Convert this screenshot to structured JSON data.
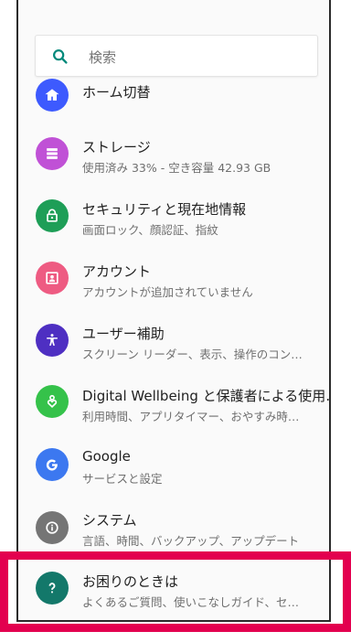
{
  "search": {
    "placeholder": "検索"
  },
  "items": [
    {
      "title": "ホーム切替",
      "subtitle": "",
      "icon": "home-icon",
      "color": "#3d5afe"
    },
    {
      "title": "ストレージ",
      "subtitle": "使用済み 33% - 空き容量 42.93 GB",
      "icon": "storage-icon",
      "color": "#c051d6"
    },
    {
      "title": "セキュリティと現在地情報",
      "subtitle": "画面ロック、顔認証、指紋",
      "icon": "lock-icon",
      "color": "#1e9e57"
    },
    {
      "title": "アカウント",
      "subtitle": "アカウントが追加されていません",
      "icon": "account-icon",
      "color": "#ee5b82"
    },
    {
      "title": "ユーザー補助",
      "subtitle": "スクリーン リーダー、表示、操作のコン…",
      "icon": "accessibility-icon",
      "color": "#4e2fc2"
    },
    {
      "title": "Digital Wellbeing と保護者による使用…",
      "subtitle": "利用時間、アプリタイマー、おやすみ時…",
      "icon": "wellbeing-icon",
      "color": "#35c24a"
    },
    {
      "title": "Google",
      "subtitle": "サービスと設定",
      "icon": "google-icon",
      "color": "#3c78f0"
    },
    {
      "title": "システム",
      "subtitle": "言語、時間、バックアップ、アップデート",
      "icon": "info-icon",
      "color": "#757575"
    },
    {
      "title": "お困りのときは",
      "subtitle": "よくあるご質問、使いこなしガイド、セ…",
      "icon": "help-icon",
      "color": "#13786a"
    }
  ],
  "colors": {
    "accent": "#00897b",
    "highlight": "#e3004f"
  }
}
